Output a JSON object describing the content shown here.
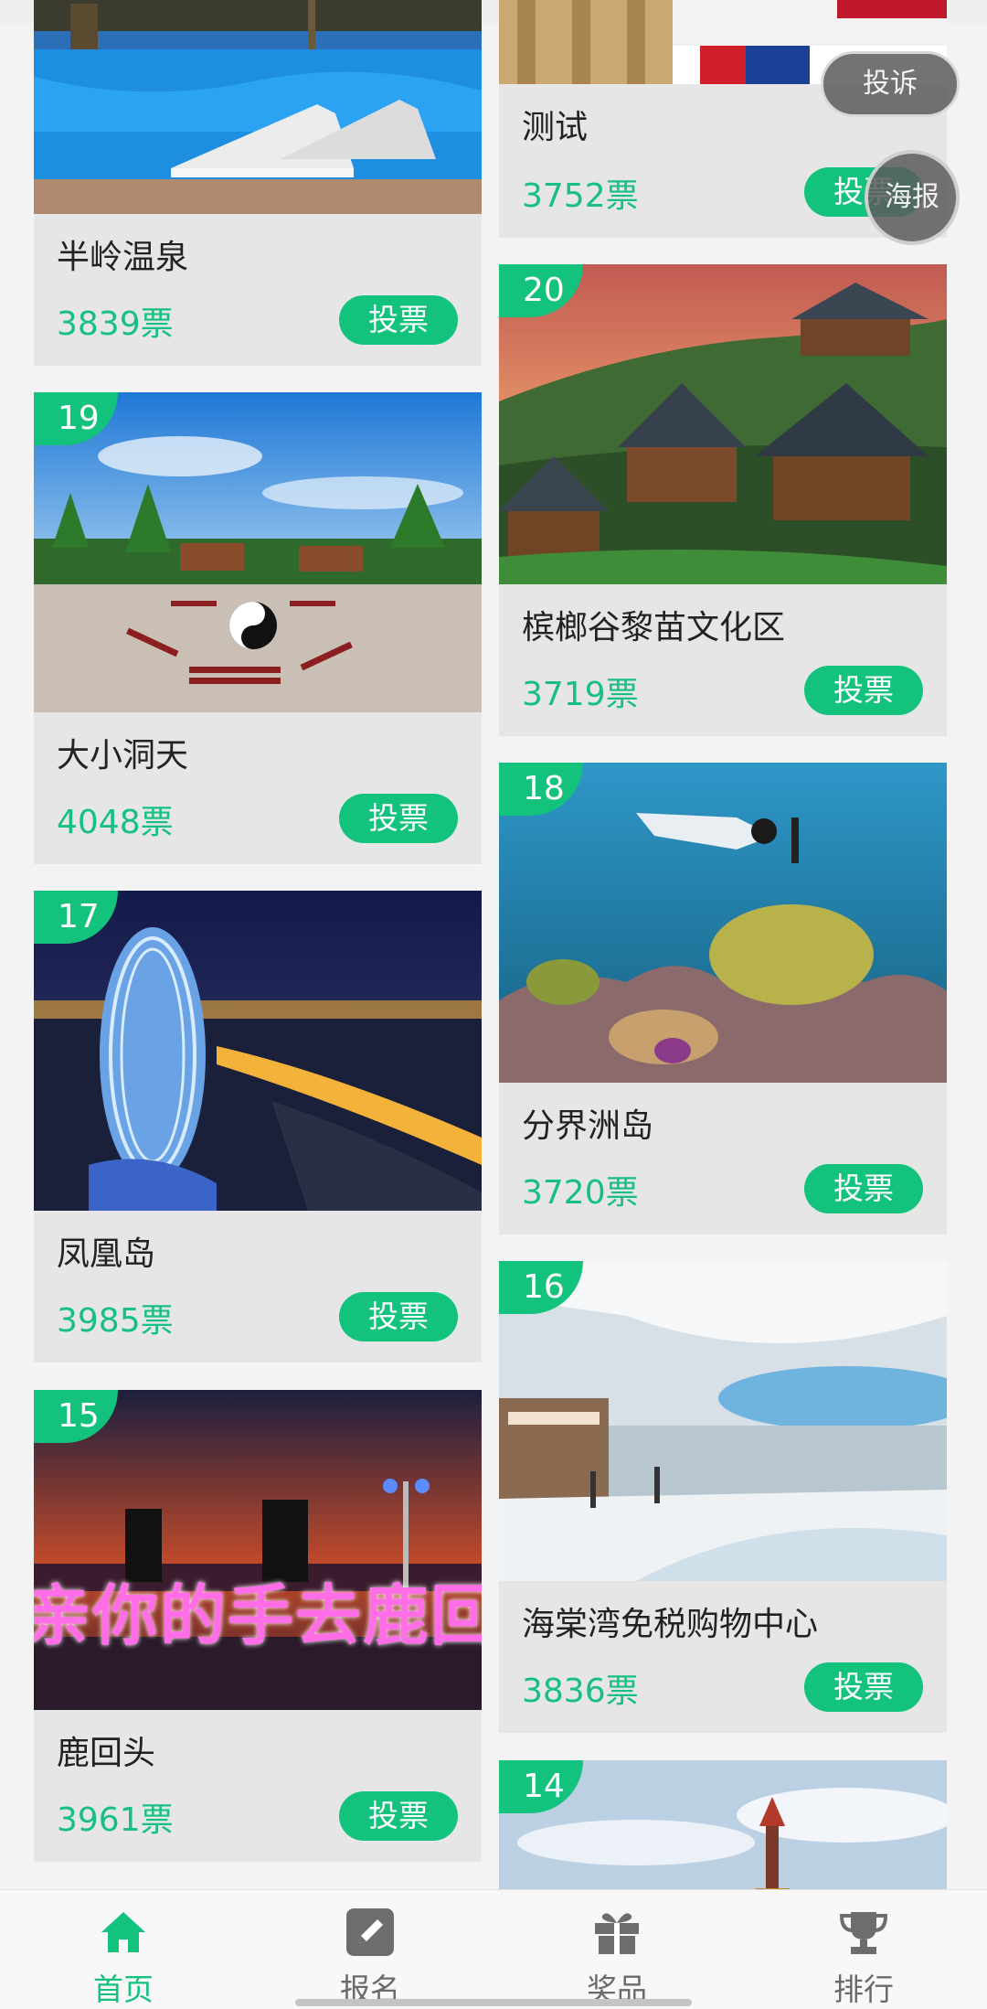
{
  "floating": {
    "complain_label": "投诉",
    "poster_label": "海报"
  },
  "cards": [
    {
      "rank": "",
      "name": "半岭温泉",
      "votes": "3839票",
      "vote_label": "投票"
    },
    {
      "rank": "",
      "name": "测试",
      "votes": "3752票",
      "vote_label": "投票"
    },
    {
      "rank": "19",
      "name": "大小洞天",
      "votes": "4048票",
      "vote_label": "投票"
    },
    {
      "rank": "20",
      "name": "槟榔谷黎苗文化区",
      "votes": "3719票",
      "vote_label": "投票"
    },
    {
      "rank": "17",
      "name": "凤凰岛",
      "votes": "3985票",
      "vote_label": "投票"
    },
    {
      "rank": "18",
      "name": "分界洲岛",
      "votes": "3720票",
      "vote_label": "投票"
    },
    {
      "rank": "15",
      "name": "鹿回头",
      "votes": "3961票",
      "vote_label": "投票"
    },
    {
      "rank": "16",
      "name": "海棠湾免税购物中心",
      "votes": "3836票",
      "vote_label": "投票"
    },
    {
      "rank": "14",
      "name": "",
      "votes": "",
      "vote_label": ""
    }
  ],
  "photo_text": {
    "luhuitou_banner": "亲你的手去鹿回"
  },
  "tabs": [
    {
      "label": "首页",
      "icon": "home-icon",
      "active": true
    },
    {
      "label": "报名",
      "icon": "edit-icon",
      "active": false
    },
    {
      "label": "奖品",
      "icon": "gift-icon",
      "active": false
    },
    {
      "label": "排行",
      "icon": "trophy-icon",
      "active": false
    }
  ],
  "colors": {
    "accent": "#13c27d",
    "vote_text": "#17c082",
    "card_bg": "#e6e6e6"
  }
}
